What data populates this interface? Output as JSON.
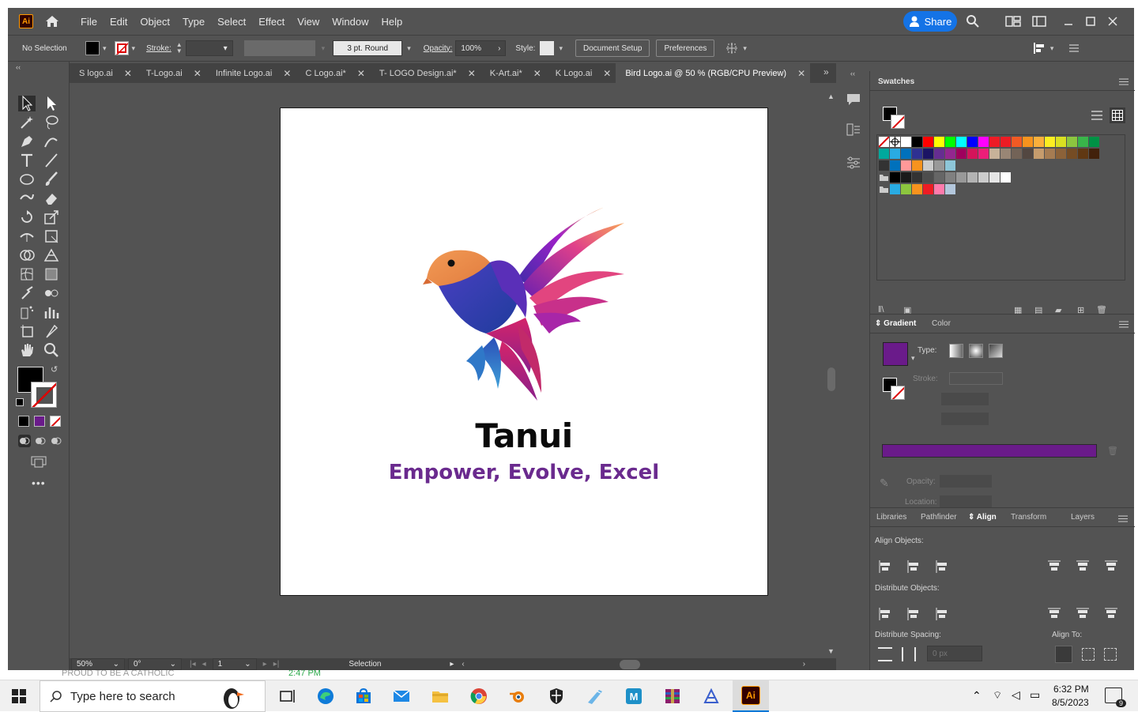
{
  "app": {
    "logo": "Ai"
  },
  "menu": [
    "File",
    "Edit",
    "Object",
    "Type",
    "Select",
    "Effect",
    "View",
    "Window",
    "Help"
  ],
  "share_label": "Share",
  "control": {
    "selection": "No Selection",
    "stroke_label": "Stroke:",
    "brush": "3 pt. Round",
    "opacity_label": "Opacity:",
    "opacity_value": "100%",
    "style_label": "Style:",
    "document_setup": "Document Setup",
    "preferences": "Preferences"
  },
  "tabs": [
    "S logo.ai",
    "T-Logo.ai",
    "Infinite Logo.ai",
    "C Logo.ai*",
    "T- LOGO Design.ai*",
    "K-Art.ai*",
    "K Logo.ai",
    "Bird Logo.ai @ 50 % (RGB/CPU Preview)"
  ],
  "artwork": {
    "brand": "Tanui",
    "tagline": "Empower, Evolve, Excel"
  },
  "status": {
    "zoom": "50%",
    "rotation": "0°",
    "artboard": "1",
    "tool": "Selection"
  },
  "swatches_panel": {
    "title": "Swatches"
  },
  "gradient_panel": {
    "tabs": [
      "Gradient",
      "Color"
    ],
    "type_label": "Type:",
    "stroke_label": "Stroke:",
    "opacity_label": "Opacity:",
    "location_label": "Location:",
    "gradient_color": "#6a1b8a"
  },
  "align_panel": {
    "tabs": [
      "Libraries",
      "Pathfinder",
      "Align",
      "Transform",
      "Layers"
    ],
    "align_objects": "Align Objects:",
    "distribute_objects": "Distribute Objects:",
    "distribute_spacing": "Distribute Spacing:",
    "align_to": "Align To:",
    "spacing_value": "0 px"
  },
  "taskbar": {
    "search_placeholder": "Type here to search",
    "time": "6:32 PM",
    "date": "8/5/2023",
    "notifications": "9",
    "background_text": "PROUD TO BE A CATHOLIC",
    "background_time": "2:47 PM"
  }
}
